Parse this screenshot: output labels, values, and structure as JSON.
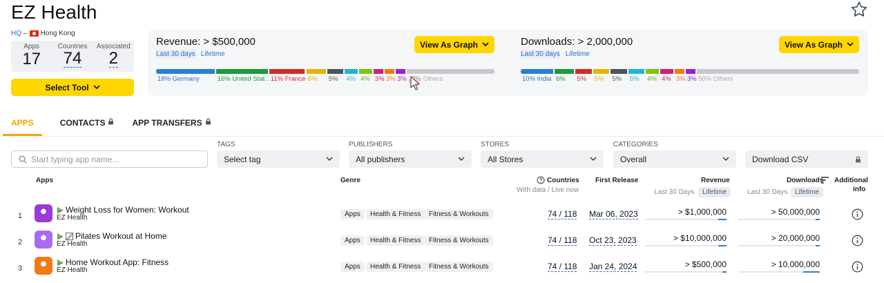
{
  "header": {
    "title": "EZ Health",
    "hq_label": "HQ",
    "hq_sep": "–",
    "hq_country": "Hong Kong",
    "favorite_icon": "star-icon"
  },
  "stats": [
    {
      "label": "Apps",
      "value": "17"
    },
    {
      "label": "Countries",
      "value": "74"
    },
    {
      "label": "Associated",
      "value": "2"
    }
  ],
  "select_tool_label": "Select Tool",
  "revenue": {
    "title": "Revenue: > $500,000",
    "tab_active": "Last 30 days",
    "tab_other": "Lifetime",
    "button": "View As Graph",
    "segments": [
      {
        "pct": 18,
        "color": "#2a7fd6",
        "label": "18% Germany",
        "label_color": "#2a6fc9"
      },
      {
        "pct": 16,
        "color": "#1a9a3c",
        "label": "16% United Stat…",
        "label_color": "#1a9a3c"
      },
      {
        "pct": 11,
        "color": "#d42a2a",
        "label": "11% France",
        "label_color": "#d42a2a"
      },
      {
        "pct": 6,
        "color": "#e8b300",
        "label": "6%",
        "label_color": "#e8b300"
      },
      {
        "pct": 5,
        "color": "#4b5560",
        "label": "5%",
        "label_color": "#4b5560"
      },
      {
        "pct": 4,
        "color": "#1fb6d1",
        "label": "4%",
        "label_color": "#1fb6d1"
      },
      {
        "pct": 4,
        "color": "#7ac70c",
        "label": "4%",
        "label_color": "#6aaa10"
      },
      {
        "pct": 3,
        "color": "#cc2277",
        "label": "3%",
        "label_color": "#cc2277"
      },
      {
        "pct": 3,
        "color": "#f07b14",
        "label": "3%",
        "label_color": "#f07b14"
      },
      {
        "pct": 3,
        "color": "#9b1fd6",
        "label": "3%",
        "label_color": "#9b1fd6"
      },
      {
        "pct": 27,
        "color": "#c6c8cb",
        "label": "27% Others",
        "label_color": "#aaaaaa"
      }
    ]
  },
  "downloads": {
    "title": "Downloads: > 2,000,000",
    "tab_active": "Last 30 days",
    "tab_other": "Lifetime",
    "button": "View As Graph",
    "segments": [
      {
        "pct": 10,
        "color": "#2a7fd6",
        "label": "10% India",
        "label_color": "#2a6fc9"
      },
      {
        "pct": 6,
        "color": "#1a9a3c",
        "label": "6%",
        "label_color": "#1a9a3c"
      },
      {
        "pct": 5,
        "color": "#d42a2a",
        "label": "5%",
        "label_color": "#d42a2a"
      },
      {
        "pct": 5,
        "color": "#e8b300",
        "label": "5%",
        "label_color": "#e8b300"
      },
      {
        "pct": 5,
        "color": "#4b5560",
        "label": "5%",
        "label_color": "#4b5560"
      },
      {
        "pct": 5,
        "color": "#1fb6d1",
        "label": "5%",
        "label_color": "#1fb6d1"
      },
      {
        "pct": 4,
        "color": "#7ac70c",
        "label": "4%",
        "label_color": "#6aaa10"
      },
      {
        "pct": 4,
        "color": "#cc2277",
        "label": "4%",
        "label_color": "#cc2277"
      },
      {
        "pct": 3,
        "color": "#f07b14",
        "label": "3%",
        "label_color": "#f07b14"
      },
      {
        "pct": 3,
        "color": "#9b1fd6",
        "label": "3%",
        "label_color": "#9b1fd6"
      },
      {
        "pct": 50,
        "color": "#c6c8cb",
        "label": "50% Others",
        "label_color": "#aaaaaa"
      }
    ]
  },
  "tabs": [
    {
      "label": "APPS",
      "locked": false,
      "active": true
    },
    {
      "label": "CONTACTS",
      "locked": true,
      "active": false
    },
    {
      "label": "APP TRANSFERS",
      "locked": true,
      "active": false
    }
  ],
  "search": {
    "placeholder": "Start typing app name..."
  },
  "filters": {
    "tags": {
      "label": "TAGS",
      "value": "Select tag"
    },
    "publishers": {
      "label": "PUBLISHERS",
      "value": "All publishers"
    },
    "stores": {
      "label": "STORES",
      "value": "All Stores"
    },
    "categories": {
      "label": "CATEGORIES",
      "value": "Overall"
    },
    "download_csv": "Download CSV"
  },
  "columns": {
    "apps": "Apps",
    "genre": "Genre",
    "countries": "Countries",
    "countries_sub": "With data / Live now",
    "first_release": "First Release",
    "revenue": "Revenue",
    "downloads": "Downloads",
    "period_30": "Last 30 Days",
    "period_life": "Lifetime",
    "additional_line1": "Additional",
    "additional_line2": "info"
  },
  "rows": [
    {
      "rank": "1",
      "name": "Weight Loss for Women: Workout",
      "publisher": "EZ Health",
      "icon_color": "#9a3ad8",
      "genres": [
        "Apps",
        "Health & Fitness",
        "Fitness & Workouts"
      ],
      "countries": "74 / 118",
      "release": "Mar 06, 2023",
      "revenue": "> $1,000,000",
      "revenue_fill": 0.1,
      "downloads": "> 50,000,000",
      "downloads_fill": 0.05,
      "extra_icon": false
    },
    {
      "rank": "2",
      "name": "Pilates Workout at Home",
      "publisher": "EZ Health",
      "icon_color": "#a86cf0",
      "genres": [
        "Apps",
        "Health & Fitness",
        "Fitness & Workouts"
      ],
      "countries": "74 / 118",
      "release": "Oct 23, 2023",
      "revenue": "> $10,000,000",
      "revenue_fill": 0.1,
      "downloads": "> 20,000,000",
      "downloads_fill": 0.05,
      "extra_icon": true
    },
    {
      "rank": "3",
      "name": "Home Workout App: Fitness",
      "publisher": "EZ Health",
      "icon_color": "#f07b14",
      "genres": [
        "Apps",
        "Health & Fitness",
        "Fitness & Workouts"
      ],
      "countries": "74 / 118",
      "release": "Jan 24, 2024",
      "revenue": "> $500,000",
      "revenue_fill": 0.05,
      "downloads": "> 10,000,000",
      "downloads_fill": 0.2,
      "extra_icon": false
    }
  ]
}
